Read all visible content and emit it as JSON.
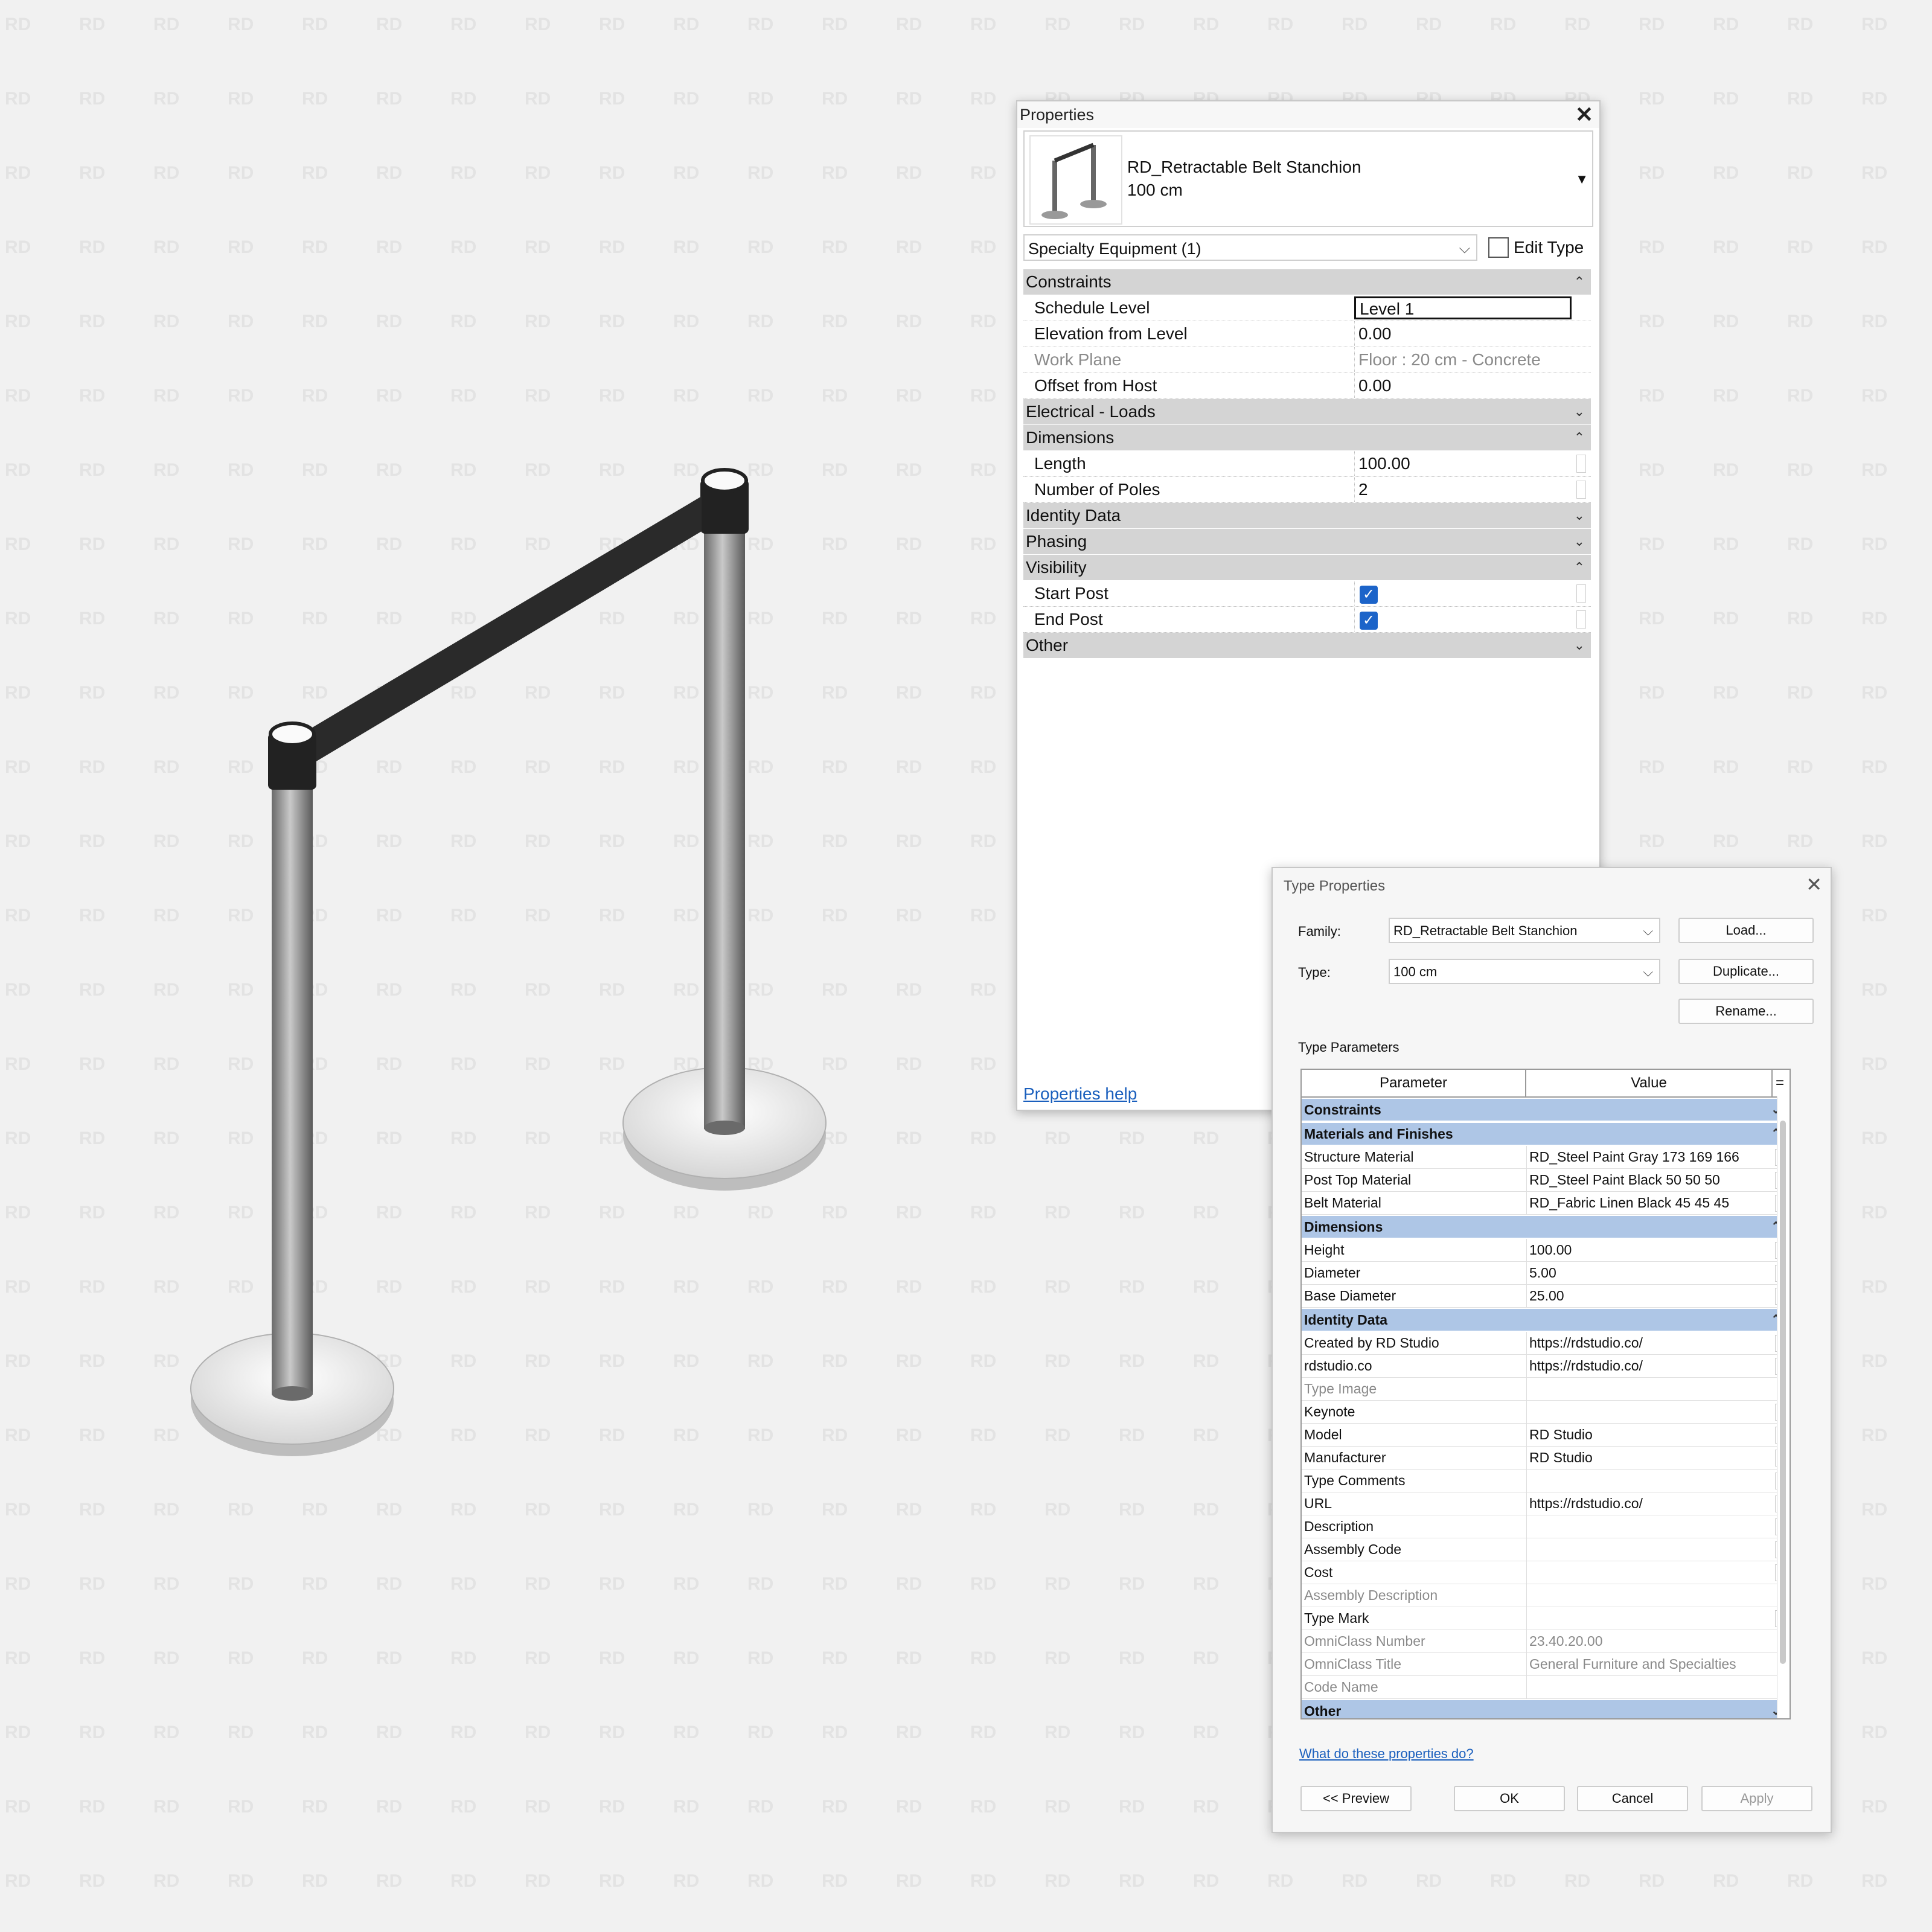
{
  "watermark": "RD",
  "properties": {
    "title": "Properties",
    "close_label": "✕",
    "type_name_line1": "RD_Retractable Belt Stanchion",
    "type_name_line2": "100 cm",
    "filter": "Specialty Equipment (1)",
    "edit_type": "Edit Type",
    "groups": {
      "constraints": "Constraints",
      "electrical": "Electrical - Loads",
      "dimensions": "Dimensions",
      "identity": "Identity Data",
      "phasing": "Phasing",
      "visibility": "Visibility",
      "other": "Other"
    },
    "rows": {
      "schedule_level": {
        "label": "Schedule Level",
        "value": "Level 1"
      },
      "elevation": {
        "label": "Elevation from Level",
        "value": "0.00"
      },
      "work_plane": {
        "label": "Work Plane",
        "value": "Floor : 20 cm - Concrete"
      },
      "offset": {
        "label": "Offset from Host",
        "value": "0.00"
      },
      "length": {
        "label": "Length",
        "value": "100.00"
      },
      "poles": {
        "label": "Number of Poles",
        "value": "2"
      },
      "start_post": {
        "label": "Start Post",
        "checked": true
      },
      "end_post": {
        "label": "End Post",
        "checked": true
      }
    },
    "help_link": "Properties help"
  },
  "type_properties": {
    "title": "Type Properties",
    "close_label": "✕",
    "family_label": "Family:",
    "family_value": "RD_Retractable Belt Stanchion",
    "type_label": "Type:",
    "type_value": "100 cm",
    "load_button": "Load...",
    "duplicate_button": "Duplicate...",
    "rename_button": "Rename...",
    "section_label": "Type Parameters",
    "col_parameter": "Parameter",
    "col_value": "Value",
    "col_eq": "=",
    "groups": {
      "constraints": "Constraints",
      "materials": "Materials and Finishes",
      "dimensions": "Dimensions",
      "identity": "Identity Data",
      "other": "Other"
    },
    "materials_rows": [
      {
        "label": "Structure Material",
        "value": "RD_Steel Paint Gray 173 169 166",
        "disabled": false
      },
      {
        "label": "Post Top Material",
        "value": "RD_Steel Paint Black 50 50 50",
        "disabled": false
      },
      {
        "label": "Belt Material",
        "value": "RD_Fabric Linen Black 45 45 45",
        "disabled": false
      }
    ],
    "dimension_rows": [
      {
        "label": "Height",
        "value": "100.00",
        "disabled": false
      },
      {
        "label": "Diameter",
        "value": "5.00",
        "disabled": false
      },
      {
        "label": "Base Diameter",
        "value": "25.00",
        "disabled": false
      }
    ],
    "identity_rows": [
      {
        "label": "Created by RD Studio",
        "value": "https://rdstudio.co/",
        "disabled": false
      },
      {
        "label": "rdstudio.co",
        "value": "https://rdstudio.co/",
        "disabled": false
      },
      {
        "label": "Type Image",
        "value": "",
        "disabled": true
      },
      {
        "label": "Keynote",
        "value": "",
        "disabled": false
      },
      {
        "label": "Model",
        "value": "RD Studio",
        "disabled": false
      },
      {
        "label": "Manufacturer",
        "value": "RD Studio",
        "disabled": false
      },
      {
        "label": "Type Comments",
        "value": "",
        "disabled": false
      },
      {
        "label": "URL",
        "value": "https://rdstudio.co/",
        "disabled": false
      },
      {
        "label": "Description",
        "value": "",
        "disabled": false
      },
      {
        "label": "Assembly Code",
        "value": "",
        "disabled": false
      },
      {
        "label": "Cost",
        "value": "",
        "disabled": false
      },
      {
        "label": "Assembly Description",
        "value": "",
        "disabled": true
      },
      {
        "label": "Type Mark",
        "value": "",
        "disabled": false
      },
      {
        "label": "OmniClass Number",
        "value": "23.40.20.00",
        "disabled": true
      },
      {
        "label": "OmniClass Title",
        "value": "General Furniture and Specialties",
        "disabled": true
      },
      {
        "label": "Code Name",
        "value": "",
        "disabled": true
      }
    ],
    "help_link": "What do these properties do?",
    "preview_button": "<< Preview",
    "ok_button": "OK",
    "cancel_button": "Cancel",
    "apply_button": "Apply"
  }
}
